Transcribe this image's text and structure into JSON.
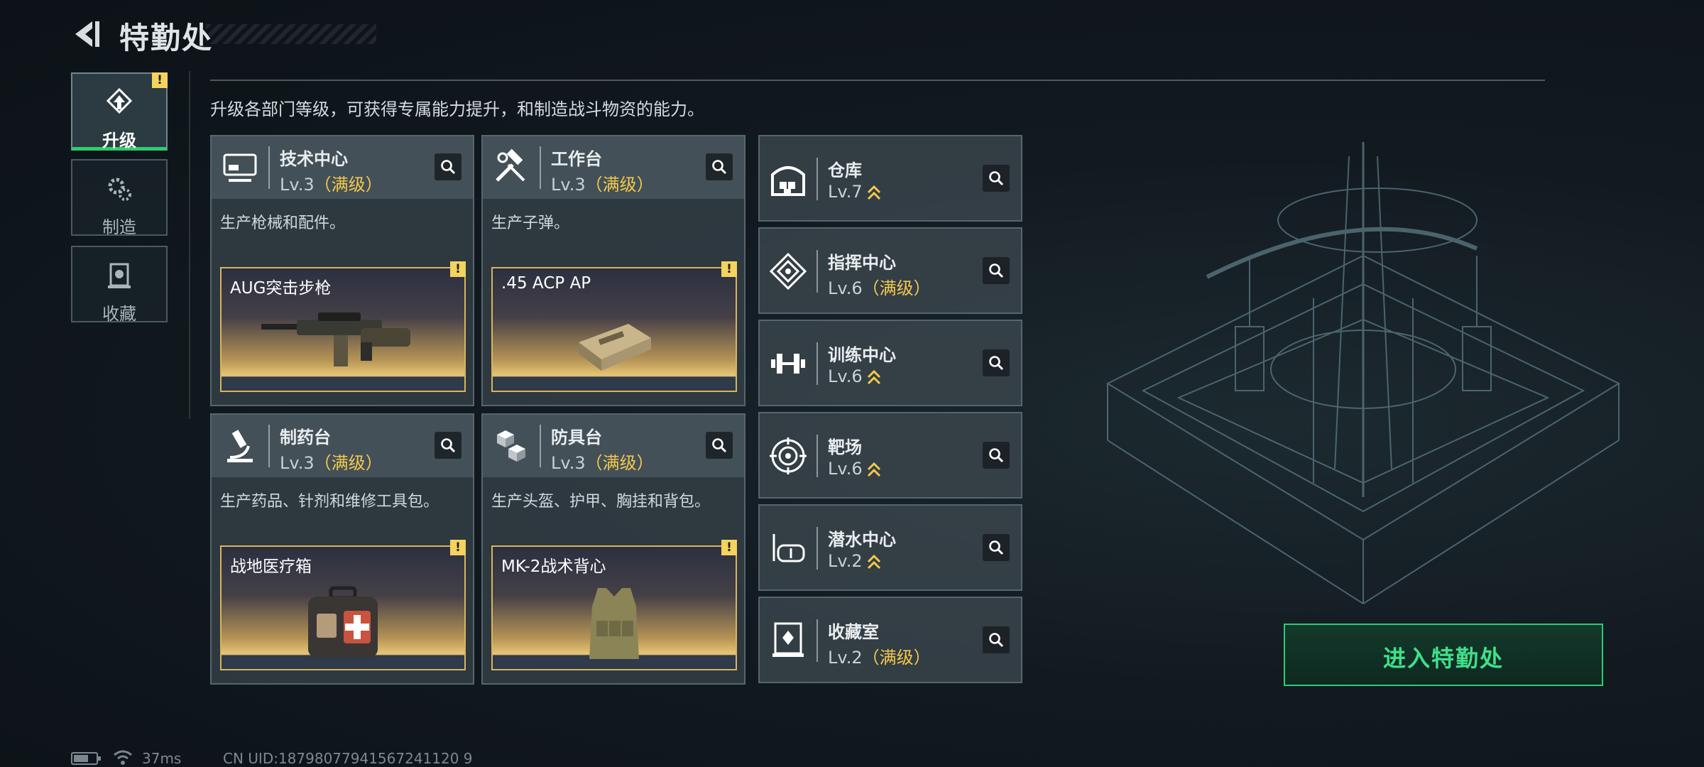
{
  "header": {
    "title": "特勤处"
  },
  "nav": [
    {
      "label": "升级",
      "icon": "upgrade-icon",
      "active": true,
      "badge": "!"
    },
    {
      "label": "制造",
      "icon": "gears-icon",
      "active": false
    },
    {
      "label": "收藏",
      "icon": "collection-icon",
      "active": false
    }
  ],
  "description": "升级各部门等级，可获得专属能力提升，和制造战斗物资的能力。",
  "cards": [
    {
      "name": "技术中心",
      "level": "Lv.3",
      "max_label": "（满级）",
      "desc": "生产枪械和配件。",
      "product": "AUG突击步枪",
      "icon": "computer-icon",
      "badge": "!"
    },
    {
      "name": "工作台",
      "level": "Lv.3",
      "max_label": "（满级）",
      "desc": "生产子弹。",
      "product": ".45 ACP AP",
      "icon": "tools-icon",
      "badge": "!"
    },
    {
      "name": "制药台",
      "level": "Lv.3",
      "max_label": "（满级）",
      "desc": "生产药品、针剂和维修工具包。",
      "product": "战地医疗箱",
      "icon": "microscope-icon",
      "badge": "!"
    },
    {
      "name": "防具台",
      "level": "Lv.3",
      "max_label": "（满级）",
      "desc": "生产头盔、护甲、胸挂和背包。",
      "product": "MK-2战术背心",
      "icon": "armor-cubes-icon",
      "badge": "!"
    }
  ],
  "rows": [
    {
      "name": "仓库",
      "level": "Lv.7",
      "max_label": "",
      "upgradable": true,
      "icon": "warehouse-icon"
    },
    {
      "name": "指挥中心",
      "level": "Lv.6",
      "max_label": "（满级）",
      "upgradable": false,
      "icon": "command-icon"
    },
    {
      "name": "训练中心",
      "level": "Lv.6",
      "max_label": "",
      "upgradable": true,
      "icon": "dumbbell-icon"
    },
    {
      "name": "靶场",
      "level": "Lv.6",
      "max_label": "",
      "upgradable": true,
      "icon": "target-icon"
    },
    {
      "name": "潜水中心",
      "level": "Lv.2",
      "max_label": "",
      "upgradable": true,
      "icon": "diving-mask-icon"
    },
    {
      "name": "收藏室",
      "level": "Lv.2",
      "max_label": "（满级）",
      "upgradable": false,
      "icon": "collection-room-icon"
    }
  ],
  "enter_button": "进入特勤处",
  "status": {
    "ping": "37ms",
    "uid": "CN UID:18798077941567241120 9"
  },
  "colors": {
    "accent_green": "#2ecc71",
    "max_gold": "#f2c94c",
    "warning": "#f4d35e"
  }
}
